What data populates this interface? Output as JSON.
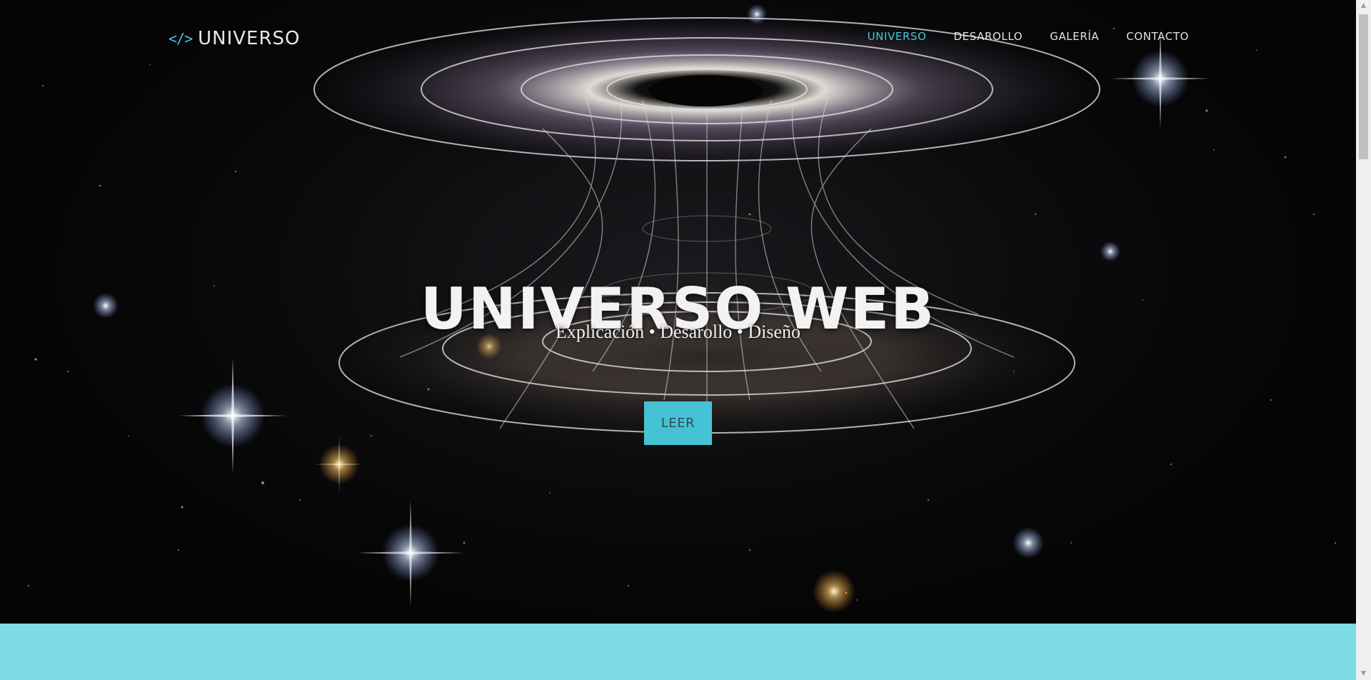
{
  "brand": {
    "icon": "code-icon",
    "icon_glyph": "</>",
    "name": "UNIVERSO"
  },
  "nav": {
    "items": [
      {
        "label": "UNIVERSO",
        "active": true
      },
      {
        "label": "DESAROLLO",
        "active": false
      },
      {
        "label": "GALERÍA",
        "active": false
      },
      {
        "label": "CONTACTO",
        "active": false
      }
    ]
  },
  "hero": {
    "title": "UNIVERSO WEB",
    "subtitle": "Explicación • Desarollo • Diseño",
    "button_label": "LEER"
  },
  "colors": {
    "accent": "#45c8d8",
    "button_bg": "#45c3d5",
    "band": "#7ddbe5",
    "background": "#0b0b0d"
  },
  "scrollbar": {
    "up_icon": "triangle-up-icon",
    "down_icon": "triangle-down-icon"
  }
}
